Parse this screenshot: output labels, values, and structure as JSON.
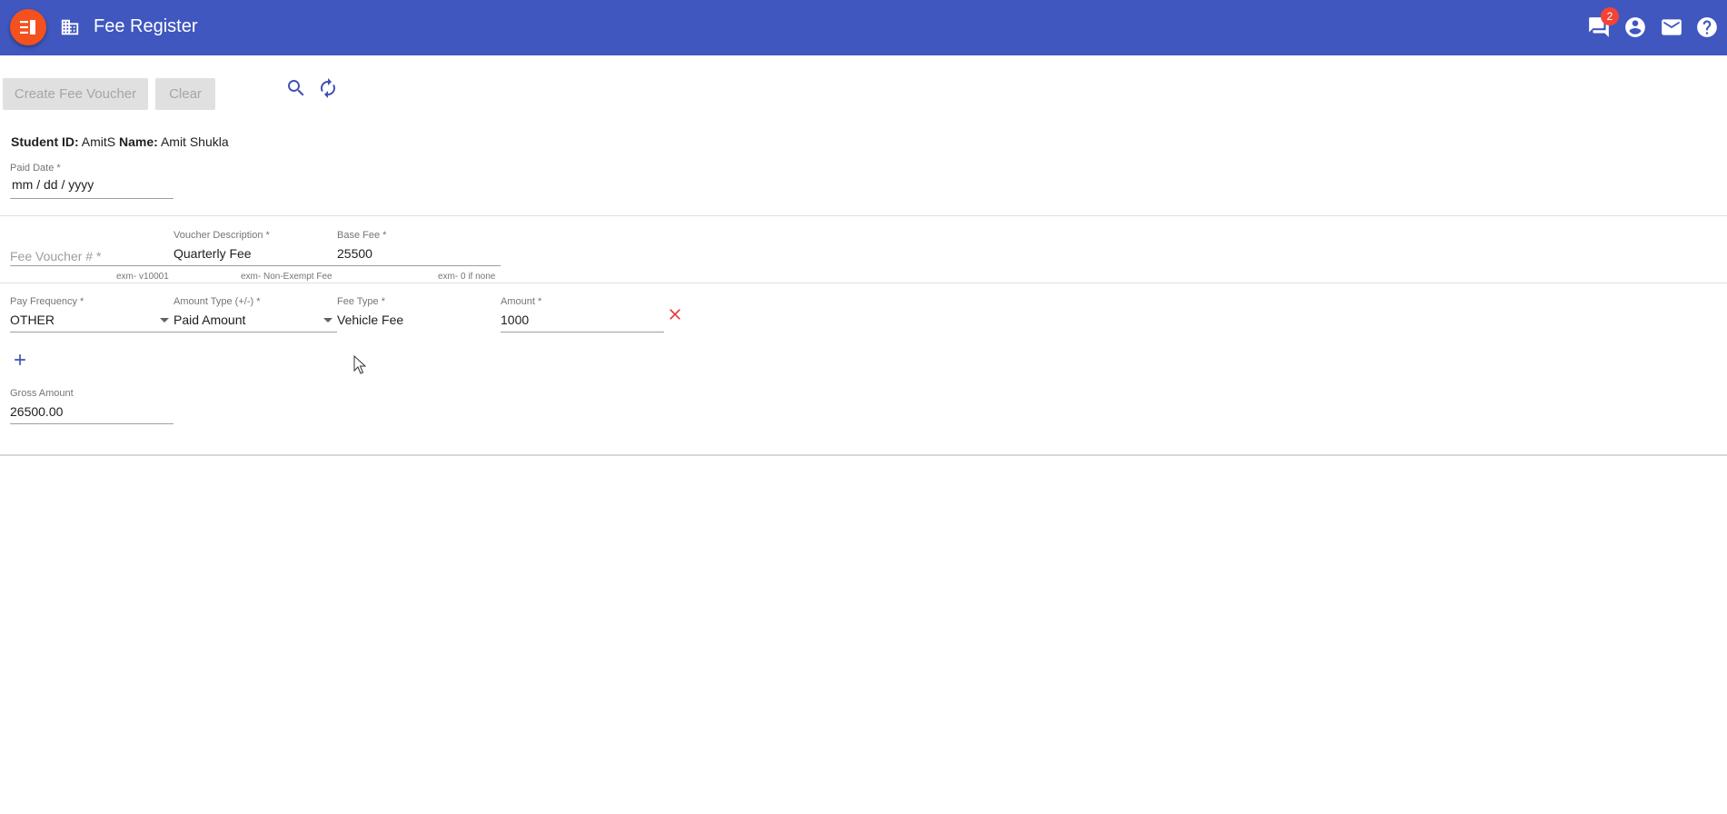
{
  "appbar": {
    "title": "Fee Register",
    "notification_count": "2",
    "icons": [
      "menu-icon",
      "building-icon",
      "chat-icon",
      "account-icon",
      "mail-icon",
      "help-icon"
    ]
  },
  "toolbar": {
    "create_label": "Create Fee Voucher",
    "clear_label": "Clear",
    "icons": [
      "search-icon",
      "refresh-icon"
    ]
  },
  "student": {
    "id_label": "Student ID:",
    "id_value": "AmitS",
    "name_label": "Name:",
    "name_value": "Amit Shukla"
  },
  "paid_date": {
    "label": "Paid Date *",
    "value": "mm / dd / yyyy"
  },
  "voucher": {
    "number_placeholder": "Fee Voucher # *",
    "number_hint": "exm- v10001",
    "description_label": "Voucher Description *",
    "description_value": "Quarterly Fee",
    "description_hint": "exm- Non-Exempt Fee",
    "base_fee_label": "Base Fee *",
    "base_fee_value": "25500",
    "base_fee_hint": "exm- 0 if none"
  },
  "fee_row": {
    "pay_frequency_label": "Pay Frequency *",
    "pay_frequency_value": "OTHER",
    "amount_type_label": "Amount Type (+/-) *",
    "amount_type_value": "Paid Amount",
    "fee_type_label": "Fee Type *",
    "fee_type_value": "Vehicle Fee",
    "amount_label": "Amount *",
    "amount_value": "1000"
  },
  "gross": {
    "label": "Gross Amount",
    "value": "26500.00"
  },
  "colors": {
    "appbar": "#3f57bf",
    "menu_button": "#f4511e",
    "badge": "#f44336",
    "delete": "#e53935",
    "accent_icon": "#3f51b5"
  }
}
